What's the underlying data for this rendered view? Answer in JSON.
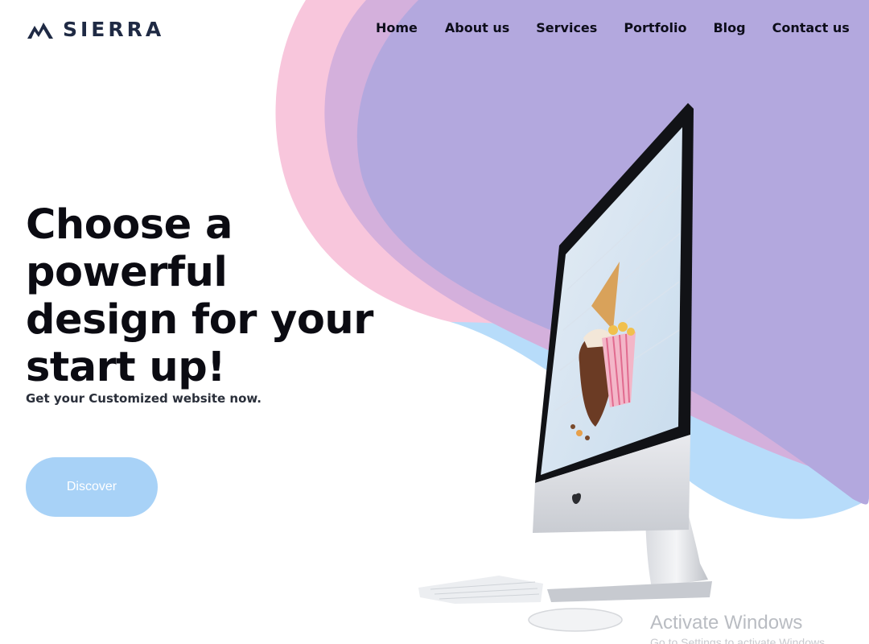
{
  "brand": {
    "name": "SIERRA",
    "logo_icon": "mountain-logo-icon"
  },
  "nav": {
    "items": [
      {
        "label": "Home"
      },
      {
        "label": "About us"
      },
      {
        "label": "Services"
      },
      {
        "label": "Portfolio"
      },
      {
        "label": "Blog"
      },
      {
        "label": "Contact us"
      }
    ]
  },
  "hero": {
    "title_lines": [
      "Choose a powerful",
      "design for your",
      "start up!"
    ],
    "subtitle": "Get your Customized website now.",
    "cta_label": "Discover"
  },
  "illustration": {
    "icon": "imac-desktop-illustration"
  },
  "watermark": {
    "title": "Activate Windows",
    "subtitle": "Go to Settings to activate Windows."
  },
  "colors": {
    "pink_blob": "#f7c4da",
    "violet_blob": "#b2a7dd",
    "blue_blob": "#a9d3f8",
    "button": "#a8d2f7",
    "heading": "#0b0b12",
    "logo": "#1f2a44"
  }
}
